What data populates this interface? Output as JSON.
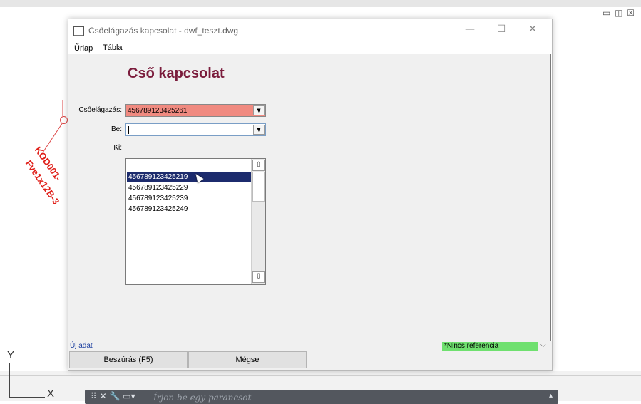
{
  "cad": {
    "window_controls": "▭ ◫ ☒",
    "axis_y": "Y",
    "axis_x": "X",
    "label_1": "KOD001-",
    "label_2": "Fve1x12B-3",
    "command_icons": "⠿ ✕ 🔧 ▭▾",
    "command_placeholder": "Írjon be egy parancsot",
    "command_dropdown": "▴"
  },
  "window": {
    "title": "Csőelágazás kapcsolat - dwf_teszt.dwg",
    "minimize": "—",
    "maximize": "☐",
    "close": "✕",
    "icon": "table-icon"
  },
  "tabs": [
    {
      "label": "Űrlap",
      "active": true
    },
    {
      "label": "Tábla",
      "active": false
    }
  ],
  "form": {
    "title": "Cső kapcsolat",
    "fields": [
      {
        "label": "Csőelágazás:",
        "value": "456789123425261",
        "highlight": "#f08a80"
      },
      {
        "label": "Be:",
        "value": ""
      },
      {
        "label": "Ki:",
        "value": ""
      }
    ],
    "dropdown_arrow": "▼",
    "dropdown_options": [
      "456789123425219",
      "456789123425229",
      "456789123425239",
      "456789123425249"
    ],
    "selected_option": "456789123425219",
    "scroll_up": "⇧",
    "scroll_down": "⇩"
  },
  "status": {
    "left": "Új adat",
    "reference": "*Nincs referencia",
    "reference_color": "#6fe06f",
    "chevron": "⌵"
  },
  "buttons": {
    "insert": "Beszúrás (F5)",
    "cancel": "Mégse"
  }
}
